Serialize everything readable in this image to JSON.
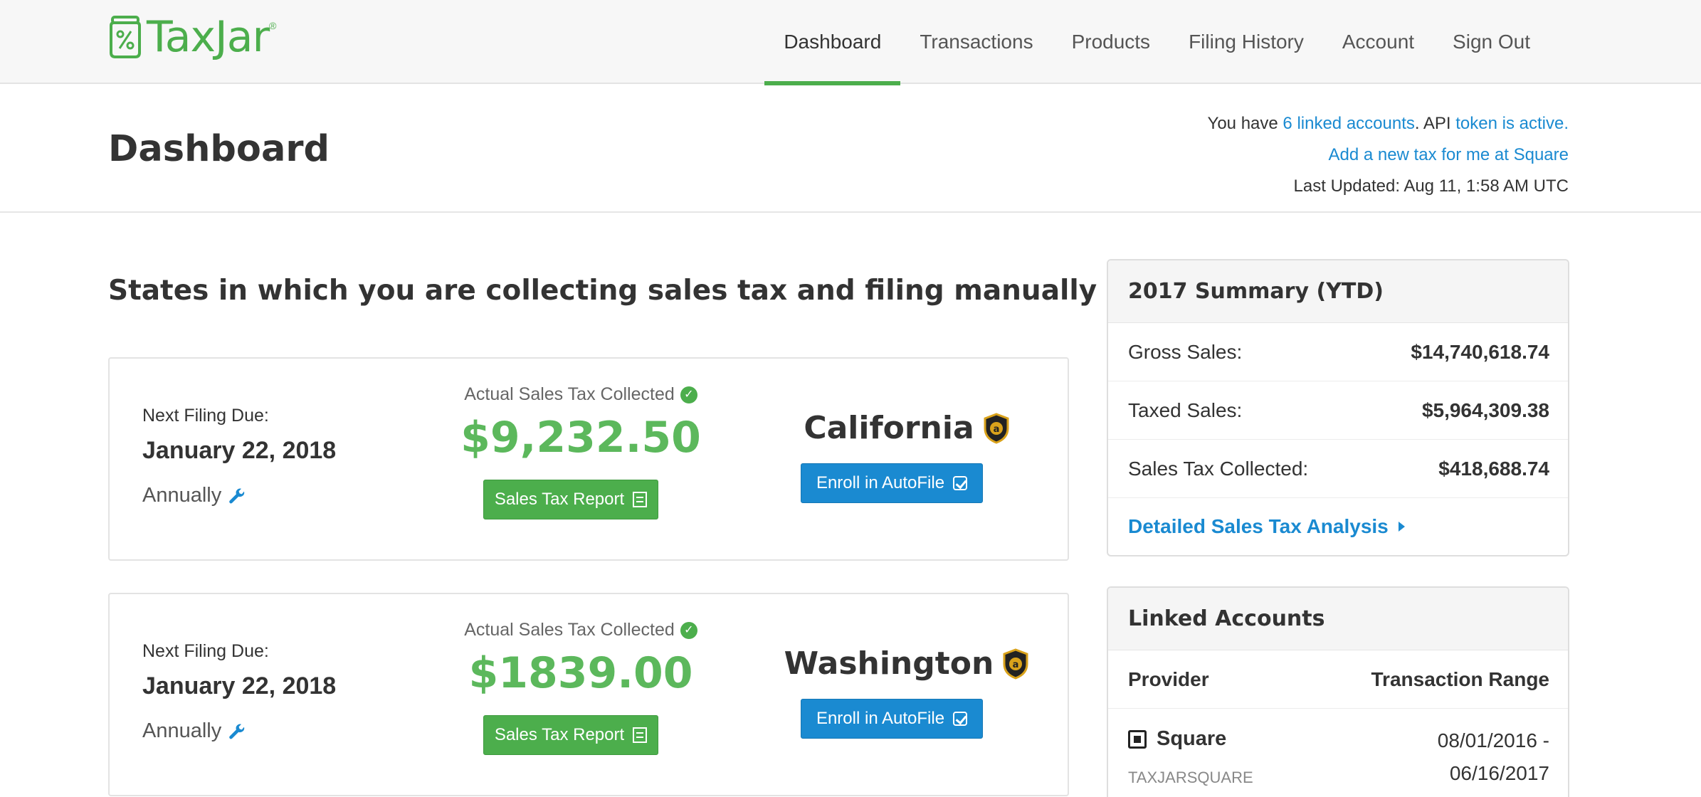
{
  "brand": {
    "name": "TaxJar",
    "reg": "®",
    "color": "#4cae4c"
  },
  "nav": {
    "items": [
      {
        "label": "Dashboard",
        "active": true
      },
      {
        "label": "Transactions",
        "active": false
      },
      {
        "label": "Products",
        "active": false
      },
      {
        "label": "Filing History",
        "active": false
      },
      {
        "label": "Account",
        "active": false
      },
      {
        "label": "Sign Out",
        "active": false
      }
    ]
  },
  "header": {
    "title": "Dashboard",
    "info": {
      "prefix": "You have ",
      "linked_link": "6 linked accounts",
      "mid": ". API ",
      "token_link": "token is active.",
      "add_tax_link": "Add a new tax for me at Square",
      "last_updated": "Last Updated: Aug 11, 1:58 AM UTC"
    }
  },
  "states_section": {
    "title": "States in which you are collecting sales tax and filing manually",
    "cards": [
      {
        "due_label": "Next Filing Due:",
        "due_date": "January 22, 2018",
        "frequency": "Annually",
        "collected_label": "Actual Sales Tax Collected",
        "amount": "$9,232.50",
        "report_button": "Sales Tax Report",
        "state": "California",
        "autofile_button": "Enroll in AutoFile"
      },
      {
        "due_label": "Next Filing Due:",
        "due_date": "January 22, 2018",
        "frequency": "Annually",
        "collected_label": "Actual Sales Tax Collected",
        "amount": "$1839.00",
        "report_button": "Sales Tax Report",
        "state": "Washington",
        "autofile_button": "Enroll in AutoFile"
      }
    ]
  },
  "summary": {
    "title": "2017 Summary (YTD)",
    "rows": [
      {
        "label": "Gross Sales:",
        "value": "$14,740,618.74"
      },
      {
        "label": "Taxed Sales:",
        "value": "$5,964,309.38"
      },
      {
        "label": "Sales Tax Collected:",
        "value": "$418,688.74"
      }
    ],
    "analysis_link": "Detailed Sales Tax Analysis"
  },
  "linked_accounts": {
    "title": "Linked Accounts",
    "columns": [
      "Provider",
      "Transaction Range"
    ],
    "rows": [
      {
        "provider": "Square",
        "account": "TAXJARSQUARE",
        "range_start": "08/01/2016 -",
        "range_end": "06/16/2017"
      }
    ]
  },
  "colors": {
    "green": "#4cae4c",
    "blue": "#1a8ad1",
    "amount_green": "#5cb85c"
  },
  "icons": [
    "taxjar-logo-icon",
    "wrench-icon",
    "check-circle-icon",
    "document-icon",
    "amazon-shield-icon",
    "checkbox-icon",
    "triangle-right-icon",
    "square-logo-icon"
  ]
}
